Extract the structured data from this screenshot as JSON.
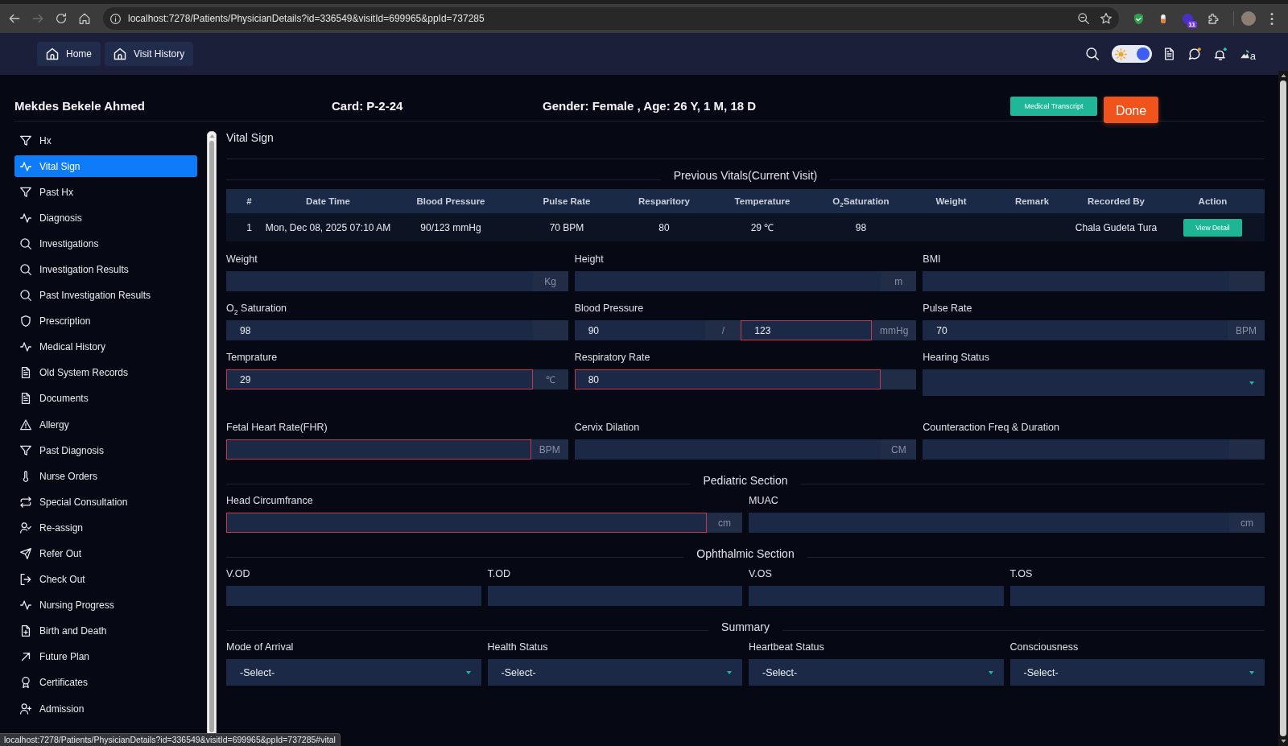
{
  "browser": {
    "url": "localhost:7278/Patients/PhysicianDetails?id=336549&visitId=699965&ppId=737285",
    "forward_button": {
      "disabled": true
    },
    "extension_badge": "11",
    "status_url": "localhost:7278/Patients/PhysicianDetails?id=336549&visitId=699965&ppId=737285#vital"
  },
  "navbar": {
    "links": [
      {
        "label": "Home"
      },
      {
        "label": "Visit History"
      }
    ],
    "theme_toggle": {
      "on": true
    },
    "avatar_alt": "a"
  },
  "patient": {
    "name": "Mekdes Bekele Ahmed",
    "card": "Card: P-2-24",
    "details": "Gender: Female , Age: 26 Y, 1 M, 18 D"
  },
  "header_buttons": [
    {
      "label": "Medical Transcript",
      "kind": "secondary"
    },
    {
      "label": "Done",
      "kind": "primary"
    }
  ],
  "sidebar": {
    "items": [
      {
        "label": "Hx",
        "kind": "filter",
        "selected": false
      },
      {
        "label": "Vital Sign",
        "kind": "pulse",
        "selected": true
      },
      {
        "label": "Past Hx",
        "kind": "filter",
        "selected": false
      },
      {
        "label": "Diagnosis",
        "kind": "pulse",
        "selected": false
      },
      {
        "label": "Investigations",
        "kind": "search",
        "selected": false
      },
      {
        "label": "Investigation Results",
        "kind": "search",
        "selected": false
      },
      {
        "label": "Past Investigation Results",
        "kind": "search",
        "selected": false
      },
      {
        "label": "Prescription",
        "kind": "shield",
        "selected": false
      },
      {
        "label": "Medical History",
        "kind": "pulse",
        "selected": false
      },
      {
        "label": "Old System Records",
        "kind": "document",
        "selected": false
      },
      {
        "label": "Documents",
        "kind": "document",
        "selected": false
      },
      {
        "label": "Allergy",
        "kind": "warning",
        "selected": false
      },
      {
        "label": "Past Diagnosis",
        "kind": "filter",
        "selected": false
      },
      {
        "label": "Nurse Orders",
        "kind": "thermometer",
        "selected": false
      },
      {
        "label": "Special Consultation",
        "kind": "repeat",
        "selected": false
      },
      {
        "label": "Re-assign",
        "kind": "user-check",
        "selected": false
      },
      {
        "label": "Refer Out",
        "kind": "send",
        "selected": false
      },
      {
        "label": "Check Out",
        "kind": "exit",
        "selected": false
      },
      {
        "label": "Nursing Progress",
        "kind": "pulse",
        "selected": false
      },
      {
        "label": "Birth and Death",
        "kind": "file-plus",
        "selected": false
      },
      {
        "label": "Future Plan",
        "kind": "arrow-up-right",
        "selected": false
      },
      {
        "label": "Certificates",
        "kind": "award",
        "selected": false
      },
      {
        "label": "Admission",
        "kind": "user-plus",
        "selected": false
      }
    ]
  },
  "panel": {
    "title": "Vital Sign"
  },
  "previous_vitals": {
    "title": "Previous Vitals(Current Visit)",
    "columns": [
      "#",
      "Date Time",
      "Blood Pressure",
      "Pulse Rate",
      "Resparitory",
      "Temperature",
      "O$_{2}$Saturation",
      "Weight",
      "Remark",
      "Recorded By",
      "Action"
    ],
    "rows": [
      {
        "number": "1",
        "date_time": "Mon, Dec 08, 2025 07:10 AM",
        "blood_pressure": "90/123 mmHg",
        "pulse_rate": "70 BPM",
        "respiratory": "80",
        "temperature": "29 ℃",
        "o2_saturation": "98",
        "recorded_by": "Chala Gudeta Tura",
        "action": "View Detail"
      }
    ]
  },
  "form_groups": [
    {
      "fields": [
        {
          "label": "Weight",
          "kind": "unit",
          "unit": "Kg",
          "invalid": false
        },
        {
          "label": "Height",
          "kind": "unit",
          "unit": "m",
          "invalid": false
        },
        {
          "label": "BMI",
          "kind": "unit",
          "invalid": false
        }
      ]
    },
    {
      "fields": [
        {
          "label": "O$_{2}$ Saturation",
          "kind": "unit",
          "value": "98",
          "invalid": false
        },
        {
          "label": "Blood Pressure",
          "kind": "pair",
          "parts": [
            {
              "value": "90",
              "invalid": false
            },
            {
              "value": "123",
              "invalid": true
            }
          ],
          "separator": "/",
          "unit": "mmHg"
        },
        {
          "label": "Pulse Rate",
          "kind": "unit",
          "value": "70",
          "unit": "BPM",
          "invalid": false
        }
      ]
    },
    {
      "fields": [
        {
          "label": "Temprature",
          "kind": "unit",
          "value": "29",
          "unit": "℃",
          "invalid": true
        },
        {
          "label": "Respiratory Rate",
          "kind": "unit",
          "value": "80",
          "invalid": true
        },
        {
          "label": "Hearing Status",
          "kind": "select",
          "invalid": false
        }
      ]
    },
    {
      "fields": [
        {
          "label": "Fetal Heart Rate(FHR)",
          "kind": "unit",
          "unit": "BPM",
          "invalid": true
        },
        {
          "label": "Cervix Dilation",
          "kind": "unit",
          "unit": "CM",
          "invalid": false
        },
        {
          "label": "Counteraction Freq & Duration",
          "kind": "unit",
          "invalid": false
        }
      ]
    },
    {
      "title": "Pediatric Section",
      "fields": [
        {
          "label": "Head Circumfrance",
          "kind": "unit",
          "unit": "cm",
          "invalid": true
        },
        {
          "label": "MUAC",
          "kind": "unit",
          "unit": "cm",
          "invalid": false
        }
      ]
    },
    {
      "title": "Ophthalmic Section",
      "fields": [
        {
          "label": "V.OD",
          "kind": "text",
          "invalid": false
        },
        {
          "label": "T.OD",
          "kind": "text",
          "invalid": false
        },
        {
          "label": "V.OS",
          "kind": "text",
          "invalid": false
        },
        {
          "label": "T.OS",
          "kind": "text",
          "invalid": false
        }
      ]
    },
    {
      "title": "Summary",
      "fields": [
        {
          "label": "Mode of Arrival",
          "kind": "select",
          "value": "-Select-",
          "invalid": false
        },
        {
          "label": "Health Status",
          "kind": "select",
          "value": "-Select-",
          "invalid": false
        },
        {
          "label": "Heartbeat Status",
          "kind": "select",
          "value": "-Select-",
          "invalid": false
        },
        {
          "label": "Consciousness",
          "kind": "select",
          "value": "-Select-",
          "invalid": false
        }
      ]
    }
  ]
}
